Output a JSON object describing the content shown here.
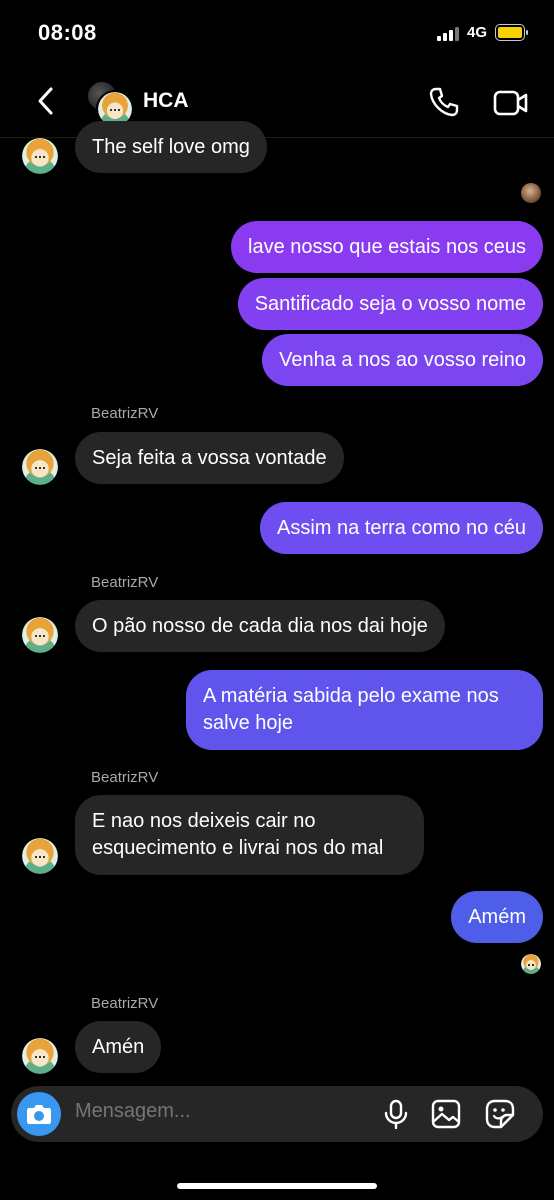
{
  "status_bar": {
    "time": "08:08",
    "network": "4G"
  },
  "header": {
    "title": "HCA"
  },
  "messages": [
    {
      "text": "The self love omg"
    },
    {
      "text": "lave nosso que estais nos ceus"
    },
    {
      "text": "Santificado seja o vosso nome"
    },
    {
      "text": "Venha a nos ao vosso reino"
    },
    {
      "sender": "BeatrizRV",
      "text": "Seja feita a vossa vontade"
    },
    {
      "text": "Assim na terra como no céu"
    },
    {
      "sender": "BeatrizRV",
      "text": "O pão nosso de cada dia nos dai hoje"
    },
    {
      "text": "A matéria sabida pelo exame nos salve hoje"
    },
    {
      "sender": "BeatrizRV",
      "text": "E nao nos deixeis cair no esquecimento e livrai nos do mal"
    },
    {
      "text": "Amém"
    },
    {
      "sender": "BeatrizRV",
      "text": "Amén"
    }
  ],
  "composer": {
    "placeholder": "Mensagem..."
  },
  "colors": {
    "incoming_bubble": "#262626",
    "outgoing_purple": "#7c3ff0",
    "outgoing_blue": "#4f5ee8",
    "camera_button": "#3897f0"
  }
}
